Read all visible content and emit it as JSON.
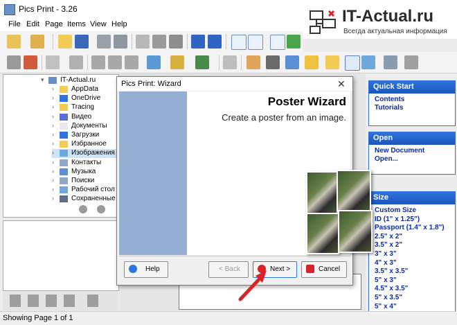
{
  "app": {
    "title": "Pics Print - 3.26"
  },
  "logo": {
    "title": "IT-Actual.ru",
    "subtitle": "Всегда актуальная информация"
  },
  "menu": [
    "File",
    "Edit",
    "Page",
    "Items",
    "View",
    "Help"
  ],
  "tree": {
    "root": "IT-Actual.ru",
    "items": [
      "AppData",
      "OneDrive",
      "Tracing",
      "Видео",
      "Документы",
      "Загрузки",
      "Избранное",
      "Изображения",
      "Контакты",
      "Музыка",
      "Поиски",
      "Рабочий стол",
      "Сохраненные и"
    ]
  },
  "wizard": {
    "title": "Pics Print: Wizard",
    "heading": "Poster Wizard",
    "subtitle": "Create a poster from an image.",
    "help": "Help",
    "back": "< Back",
    "next": "Next >",
    "cancel": "Cancel"
  },
  "panels": {
    "quick_start": {
      "title": "Quick Start",
      "links": [
        "Contents",
        "Tutorials"
      ]
    },
    "open": {
      "title": "Open",
      "links": [
        "New Document",
        "Open..."
      ]
    },
    "size": {
      "title": "Size",
      "links": [
        "Custom Size",
        "ID (1\" x 1.25\")",
        "Passport (1.4\" x 1.8\")",
        "2.5\" x 2\"",
        "3.5\" x 2\"",
        "3\" x 3\"",
        "4\" x 3\"",
        "3.5\" x 3.5\"",
        "5\" x 3\"",
        "4.5\" x 3.5\"",
        "5\" x 3.5\"",
        "5\" x 4\""
      ]
    }
  },
  "status": {
    "text": "Showing Page 1 of 1"
  },
  "colors": {
    "accent": "#2e74e0",
    "link": "#0a2aa8",
    "wizard_side": "#94afd1",
    "logo_red": "#d8232a"
  }
}
